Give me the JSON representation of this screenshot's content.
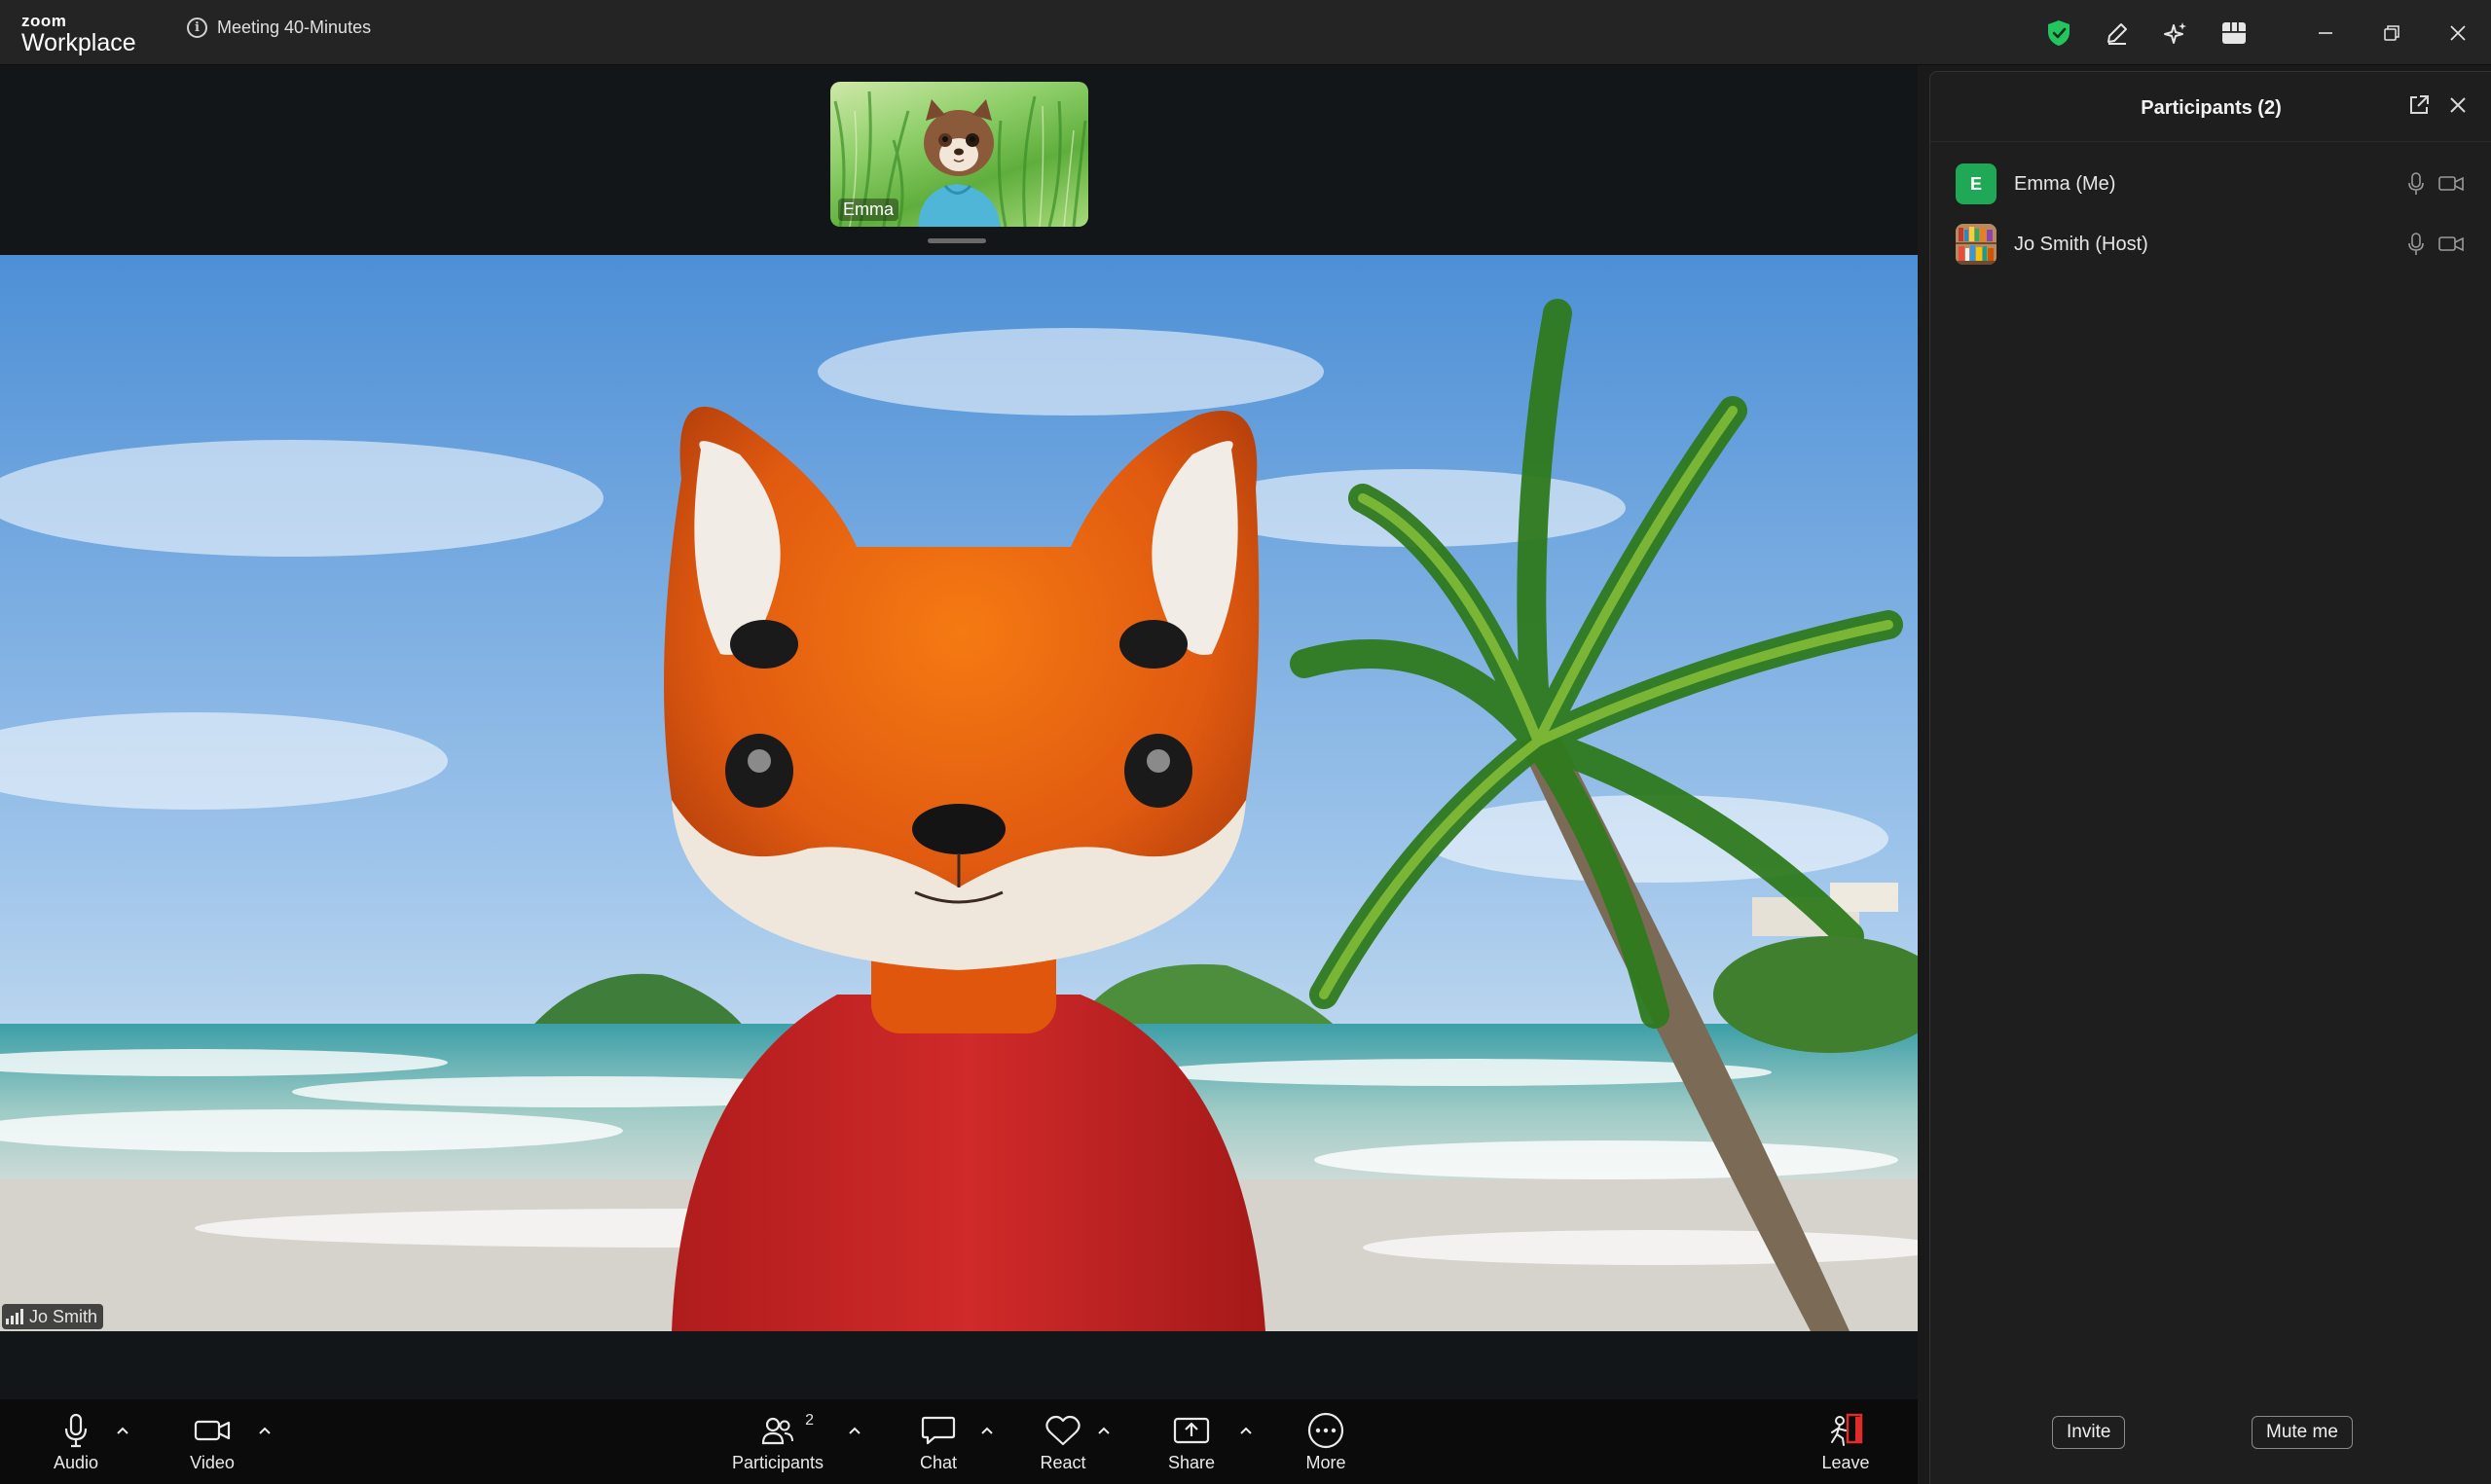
{
  "app": {
    "brand_small": "zoom",
    "brand_large": "Workplace"
  },
  "meeting": {
    "title": "Meeting 40-Minutes"
  },
  "titlebar_icons": [
    "shield-check-icon",
    "pencil-icon",
    "sparkle-icon",
    "apps-grid-icon"
  ],
  "colors": {
    "security_green": "#22c55e",
    "avatar_green": "#1fa855",
    "leave_red": "#e02b2b",
    "panel_bg": "#1e1e1e"
  },
  "thumbnail": {
    "name": "Emma"
  },
  "main_video": {
    "name": "Jo Smith"
  },
  "toolbar": {
    "audio": "Audio",
    "video": "Video",
    "participants": "Participants",
    "participants_count": "2",
    "chat": "Chat",
    "react": "React",
    "share": "Share",
    "more": "More",
    "leave": "Leave"
  },
  "panel": {
    "title": "Participants (2)",
    "participants": [
      {
        "initial": "E",
        "name": "Emma (Me)"
      },
      {
        "initial": "",
        "name": "Jo Smith (Host)"
      }
    ],
    "invite": "Invite",
    "mute": "Mute me"
  }
}
